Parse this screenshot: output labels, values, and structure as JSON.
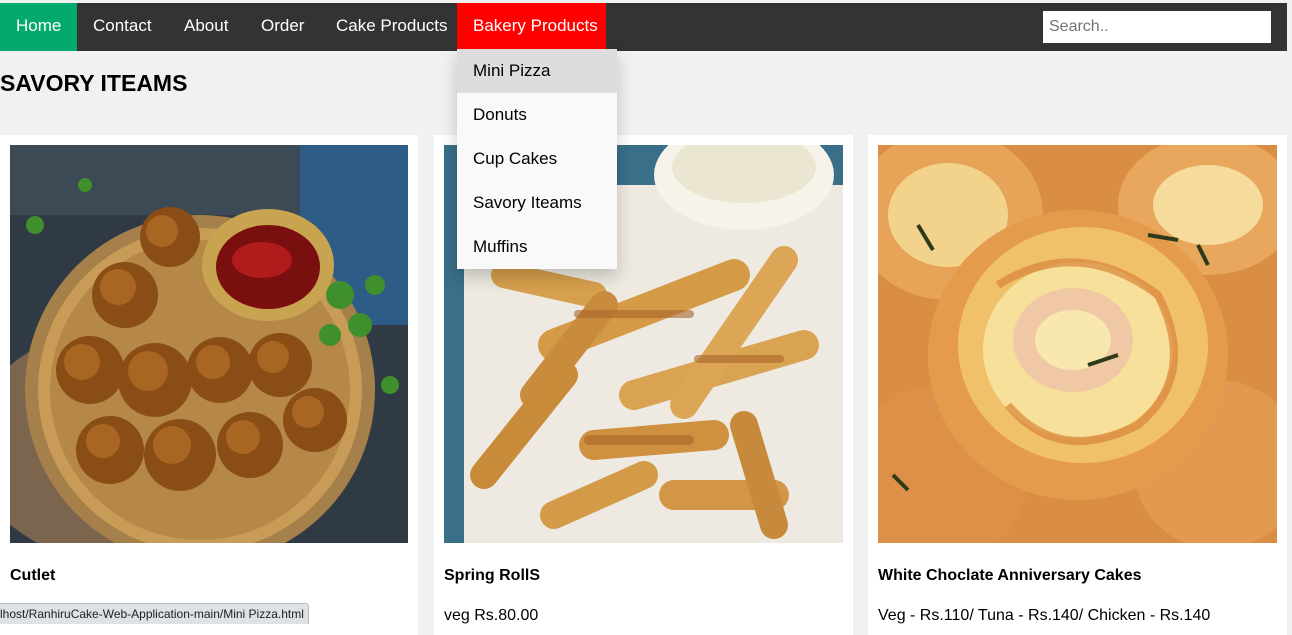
{
  "nav": {
    "home": "Home",
    "contact": "Contact",
    "about": "About",
    "order": "Order",
    "cake_products": "Cake Products",
    "bakery_products": "Bakery Products",
    "active_color": "#04aa6d",
    "hover_color": "#ff0000",
    "bar_color": "#333333"
  },
  "search": {
    "placeholder": "Search.."
  },
  "page": {
    "heading": "SAVORY ITEAMS"
  },
  "dropdown": {
    "items": [
      {
        "label": "Mini Pizza",
        "hovered": true
      },
      {
        "label": "Donuts"
      },
      {
        "label": "Cup Cakes"
      },
      {
        "label": "Savory Iteams"
      },
      {
        "label": "Muffins"
      }
    ]
  },
  "cards": [
    {
      "title": "Cutlet",
      "price": "",
      "image": "cutlet-photo"
    },
    {
      "title": "Spring RollS",
      "price": "veg Rs.80.00",
      "image": "spring-rolls-photo"
    },
    {
      "title": "White Choclate Anniversary Cakes",
      "price": "Veg - Rs.110/ Tuna - Rs.140/ Chicken - Rs.140",
      "image": "pastry-swirls-photo"
    }
  ],
  "status_bar": {
    "url": "lhost/RanhiruCake-Web-Application-main/Mini Pizza.html"
  }
}
